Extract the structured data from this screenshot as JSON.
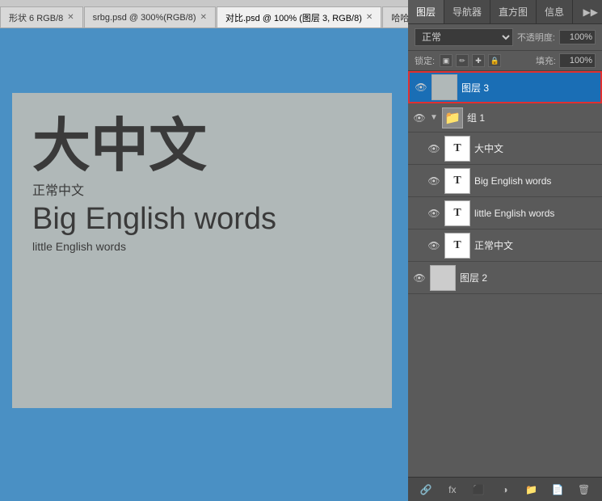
{
  "tabs": [
    {
      "label": "形状 6 RGB/8",
      "active": false,
      "closable": true
    },
    {
      "label": "srbg.psd @ 300%(RGB/8)",
      "active": false,
      "closable": true
    },
    {
      "label": "对比.psd @ 100% (图层 3, RGB/8)",
      "active": true,
      "closable": true
    },
    {
      "label": "哈哈...",
      "active": false,
      "closable": false
    }
  ],
  "canvas": {
    "big_chinese": "大中文",
    "normal_chinese": "正常中文",
    "big_english": "Big English words",
    "little_english": "little English words"
  },
  "panels": {
    "tabs": [
      "图层",
      "导航器",
      "直方图",
      "信息"
    ],
    "active_tab": "图层"
  },
  "layers_panel": {
    "mode": "正常",
    "opacity_label": "不透明度:",
    "opacity_value": "100%",
    "lock_label": "锁定:",
    "fill_label": "填充:",
    "fill_value": "100%",
    "layers": [
      {
        "id": "layer3",
        "name": "图层 3",
        "type": "raster",
        "visible": true,
        "selected": true,
        "thumb": "preview"
      },
      {
        "id": "group1",
        "name": "组 1",
        "type": "group",
        "visible": true,
        "selected": false,
        "expanded": true
      },
      {
        "id": "text-big-chinese",
        "name": "大中文",
        "type": "text",
        "visible": true,
        "selected": false,
        "indent": true
      },
      {
        "id": "text-big-english",
        "name": "Big English words",
        "type": "text",
        "visible": true,
        "selected": false,
        "indent": true
      },
      {
        "id": "text-little-english",
        "name": "little English words",
        "type": "text",
        "visible": true,
        "selected": false,
        "indent": true
      },
      {
        "id": "text-normal-chinese",
        "name": "正常中文",
        "type": "text",
        "visible": true,
        "selected": false,
        "indent": true
      },
      {
        "id": "layer2",
        "name": "图层 2",
        "type": "raster",
        "visible": true,
        "selected": false
      }
    ],
    "bottom_buttons": [
      "link-icon",
      "fx-icon",
      "mask-icon",
      "adjustment-icon",
      "folder-icon",
      "new-icon",
      "trash-icon"
    ]
  }
}
